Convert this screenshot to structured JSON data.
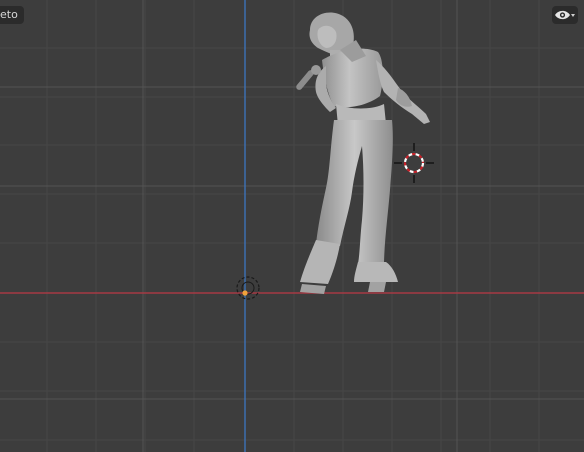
{
  "viewport": {
    "object_label": "eto",
    "background_color": "#3d3d3d",
    "grid_color": "#4a4a4a",
    "x_axis_color": "#a63a44",
    "y_axis_color": "#3d6fb0"
  },
  "overlays": {
    "visibility_icon": "eye-icon",
    "dropdown_icon": "chevron-down-icon"
  },
  "scene": {
    "object": "singer-figure-model",
    "cursor_icon": "3d-cursor-icon",
    "origin_icon": "object-origin-icon"
  }
}
